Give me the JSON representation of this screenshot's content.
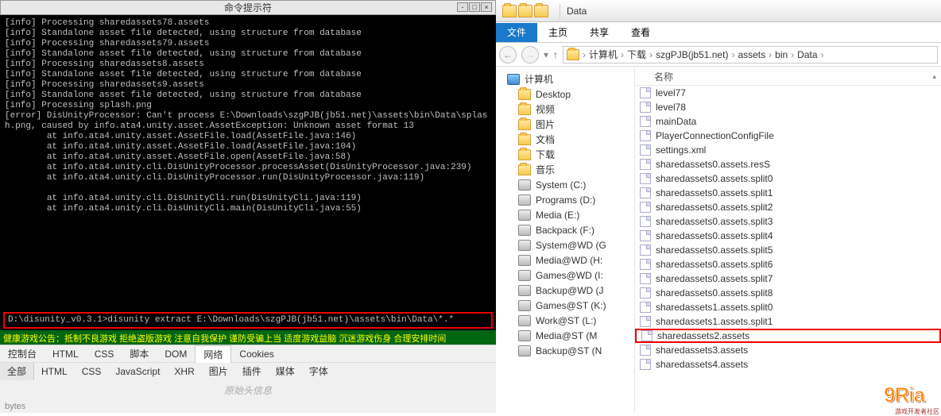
{
  "terminal": {
    "title": "命令提示符",
    "lines": [
      "[info] Processing sharedassets78.assets",
      "[info] Standalone asset file detected, using structure from database",
      "[info] Processing sharedassets79.assets",
      "[info] Standalone asset file detected, using structure from database",
      "[info] Processing sharedassets8.assets",
      "[info] Standalone asset file detected, using structure from database",
      "[info] Processing sharedassets9.assets",
      "[info] Standalone asset file detected, using structure from database",
      "[info] Processing splash.png",
      "[error] DisUnityProcessor: Can't process E:\\Downloads\\szgPJB(jb51.net)\\assets\\bin\\Data\\splash.png, caused by info.ata4.unity.asset.AssetException: Unknown asset format 13",
      "        at info.ata4.unity.asset.AssetFile.load(AssetFile.java:146)",
      "        at info.ata4.unity.asset.AssetFile.load(AssetFile.java:104)",
      "        at info.ata4.unity.asset.AssetFile.open(AssetFile.java:58)",
      "        at info.ata4.unity.cli.DisUnityProcessor.processAsset(DisUnityProcessor.java:239)",
      "        at info.ata4.unity.cli.DisUnityProcessor.run(DisUnityProcessor.java:119)",
      "",
      "        at info.ata4.unity.cli.DisUnityCli.run(DisUnityCli.java:119)",
      "        at info.ata4.unity.cli.DisUnityCli.main(DisUnityCli.java:55)",
      ""
    ],
    "command": "D:\\disunity_v0.3.1>disunity extract E:\\Downloads\\szgPJB(jb51.net)\\assets\\bin\\Data\\*.*",
    "notice": "健康游戏公告：抵制不良游戏 拒绝盗版游戏 注意自我保护 谨防受骗上当 适度游戏益脑 沉迷游戏伤身 合理安排时间"
  },
  "devtools": {
    "row1": [
      "控制台",
      "HTML",
      "CSS",
      "脚本",
      "DOM",
      "网络",
      "Cookies"
    ],
    "row1_active": "网络",
    "row2": [
      "全部",
      "HTML",
      "CSS",
      "JavaScript",
      "XHR",
      "图片",
      "插件",
      "媒体",
      "字体"
    ],
    "raw_header": "原始头信息",
    "bytes_label": "bytes"
  },
  "explorer": {
    "window_title": "Data",
    "ribbon": {
      "file": "文件",
      "home": "主页",
      "share": "共享",
      "view": "查看"
    },
    "breadcrumbs": [
      "计算机",
      "下载",
      "szgPJB(jb51.net)",
      "assets",
      "bin",
      "Data"
    ],
    "col_header": "名称",
    "side": {
      "computer": "计算机",
      "items": [
        {
          "label": "Desktop",
          "type": "folder"
        },
        {
          "label": "视频",
          "type": "folder"
        },
        {
          "label": "图片",
          "type": "folder"
        },
        {
          "label": "文档",
          "type": "folder"
        },
        {
          "label": "下载",
          "type": "folder"
        },
        {
          "label": "音乐",
          "type": "folder"
        },
        {
          "label": "System (C:)",
          "type": "disk"
        },
        {
          "label": "Programs (D:)",
          "type": "disk"
        },
        {
          "label": "Media (E:)",
          "type": "disk"
        },
        {
          "label": "Backpack (F:)",
          "type": "disk"
        },
        {
          "label": "System@WD (G",
          "type": "disk"
        },
        {
          "label": "Media@WD (H:",
          "type": "disk"
        },
        {
          "label": "Games@WD (I:",
          "type": "disk"
        },
        {
          "label": "Backup@WD (J",
          "type": "disk"
        },
        {
          "label": "Games@ST (K:)",
          "type": "disk"
        },
        {
          "label": "Work@ST (L:)",
          "type": "disk"
        },
        {
          "label": "Media@ST (M",
          "type": "disk"
        },
        {
          "label": "Backup@ST (N",
          "type": "disk"
        }
      ]
    },
    "files": [
      "level77",
      "level78",
      "mainData",
      "PlayerConnectionConfigFile",
      "settings.xml",
      "sharedassets0.assets.resS",
      "sharedassets0.assets.split0",
      "sharedassets0.assets.split1",
      "sharedassets0.assets.split2",
      "sharedassets0.assets.split3",
      "sharedassets0.assets.split4",
      "sharedassets0.assets.split5",
      "sharedassets0.assets.split6",
      "sharedassets0.assets.split7",
      "sharedassets0.assets.split8",
      "sharedassets1.assets.split0",
      "sharedassets1.assets.split1",
      "sharedassets2.assets",
      "sharedassets3.assets",
      "sharedassets4.assets"
    ],
    "selected_file": "sharedassets2.assets"
  },
  "watermark": {
    "brand": "9Ria",
    "sub": "游戏开发者社区"
  }
}
